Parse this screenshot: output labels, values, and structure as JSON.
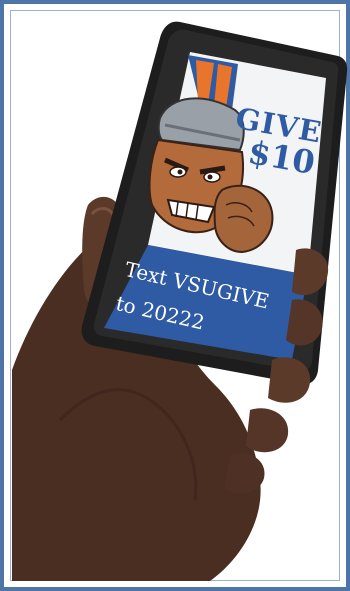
{
  "promo": {
    "give_word": "GIVE",
    "give_amount": "$10",
    "text_line1": "Text VSUGIVE",
    "text_line2": "to 20222"
  },
  "colors": {
    "frame": "#4f74a8",
    "screen_blue": "#2f5aa4",
    "phone_body": "#1d1d1d",
    "skin": "#5b3a2a"
  },
  "icons": {
    "mascot": "trojan-warrior-mascot-icon"
  }
}
